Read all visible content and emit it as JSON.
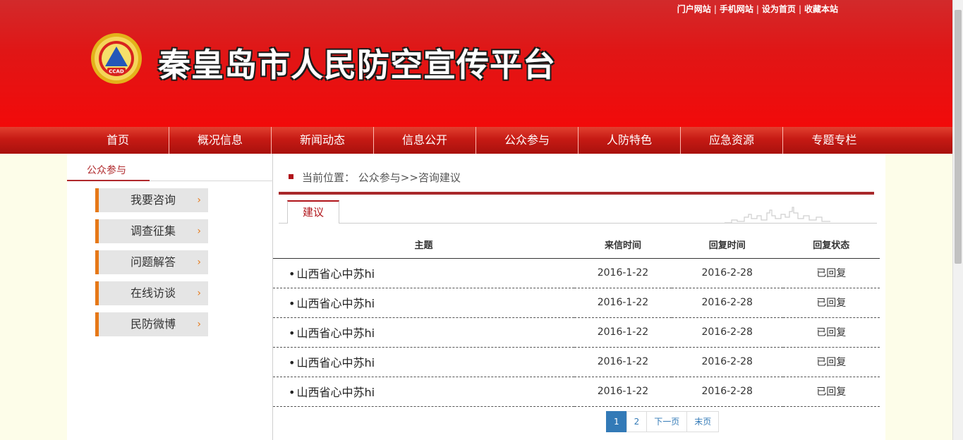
{
  "header": {
    "top_links": [
      "门户网站",
      "手机网站",
      "设为首页",
      "收藏本站"
    ],
    "title": "秦皇岛市人民防空宣传平台",
    "logo_text": "CCAD"
  },
  "nav": [
    "首页",
    "概况信息",
    "新闻动态",
    "信息公开",
    "公众参与",
    "人防特色",
    "应急资源",
    "专题专栏"
  ],
  "sidebar": {
    "title": "公众参与",
    "items": [
      "我要咨询",
      "调查征集",
      "问题解答",
      "在线访谈",
      "民防微博"
    ]
  },
  "breadcrumb": {
    "label": "当前位置：",
    "path": "公众参与>>咨询建议"
  },
  "tab_label": "建议",
  "table": {
    "headers": [
      "主题",
      "来信时间",
      "回复时间",
      "回复状态"
    ],
    "rows": [
      {
        "subject": "山西省心中苏hi",
        "sent": "2016-1-22",
        "replied": "2016-2-28",
        "status": "已回复"
      },
      {
        "subject": "山西省心中苏hi",
        "sent": "2016-1-22",
        "replied": "2016-2-28",
        "status": "已回复"
      },
      {
        "subject": "山西省心中苏hi",
        "sent": "2016-1-22",
        "replied": "2016-2-28",
        "status": "已回复"
      },
      {
        "subject": "山西省心中苏hi",
        "sent": "2016-1-22",
        "replied": "2016-2-28",
        "status": "已回复"
      },
      {
        "subject": "山西省心中苏hi",
        "sent": "2016-1-22",
        "replied": "2016-2-28",
        "status": "已回复"
      }
    ]
  },
  "pager": {
    "pages": [
      "1",
      "2"
    ],
    "current": "1",
    "next": "下一页",
    "last": "末页"
  },
  "colors": {
    "header_red": "#e01616",
    "nav_red": "#c61a14",
    "accent_orange": "#e67817",
    "rule_red": "#a8282a",
    "pager_blue": "#337ab7"
  }
}
